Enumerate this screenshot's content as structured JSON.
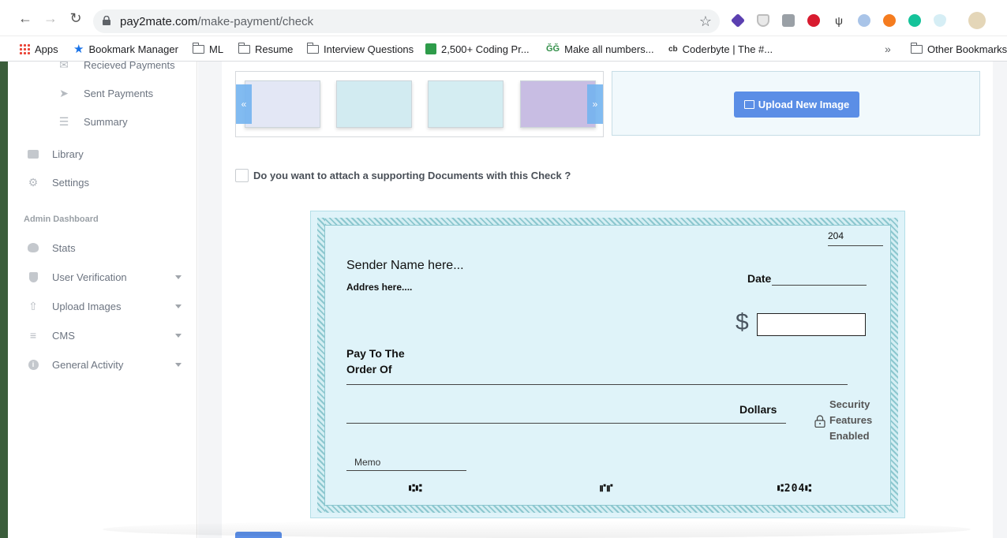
{
  "browser": {
    "url_host": "pay2mate.com",
    "url_path": "/make-payment/check"
  },
  "bookmarks": [
    {
      "label": "Apps",
      "icon": "apps-grid-icon"
    },
    {
      "label": "Bookmark Manager",
      "icon": "star-icon"
    },
    {
      "label": "ML",
      "icon": "folder-icon"
    },
    {
      "label": "Resume",
      "icon": "folder-icon"
    },
    {
      "label": "Interview Questions",
      "icon": "folder-icon"
    },
    {
      "label": "2,500+ Coding Pr...",
      "icon": "site-favicon"
    },
    {
      "label": "Make all numbers...",
      "icon": "gfg-favicon"
    },
    {
      "label": "Coderbyte | The #...",
      "icon": "coderbyte-favicon"
    }
  ],
  "bookmarks_more": "»",
  "other_bookmarks": "Other Bookmarks",
  "sidebar": {
    "sub_items": [
      {
        "label": "Recieved Payments",
        "icon": "envelope-open-icon"
      },
      {
        "label": "Sent Payments",
        "icon": "paper-plane-icon"
      },
      {
        "label": "Summary",
        "icon": "table-list-icon"
      }
    ],
    "items": [
      {
        "label": "Library",
        "icon": "briefcase-icon"
      },
      {
        "label": "Settings",
        "icon": "gear-icon"
      }
    ],
    "admin_heading": "Admin Dashboard",
    "admin_items": [
      {
        "label": "Stats",
        "icon": "palette-icon",
        "has_caret": false
      },
      {
        "label": "User Verification",
        "icon": "shield-icon",
        "has_caret": true
      },
      {
        "label": "Upload Images",
        "icon": "upload-icon",
        "has_caret": true
      },
      {
        "label": "CMS",
        "icon": "align-left-icon",
        "has_caret": true
      },
      {
        "label": "General Activity",
        "icon": "info-circle-icon",
        "has_caret": true
      }
    ]
  },
  "carousel": {
    "prev": "«",
    "next": "»",
    "thumbnail_colors": [
      "#e3e7f5",
      "#d2ebf1",
      "#d4edf2",
      "#c8bde3"
    ]
  },
  "upload": {
    "button_label": "Upload New Image"
  },
  "attach_documents_label": "Do you want to attach a supporting Documents with this Check ?",
  "check": {
    "number": "204",
    "sender_name": "Sender Name here...",
    "address": "Addres here....",
    "date_label": "Date",
    "currency_symbol": "$",
    "pay_to_line1": "Pay To The",
    "pay_to_line2": "Order Of",
    "dollars_label": "Dollars",
    "security_line1": "Security",
    "security_line2": "Features",
    "security_line3": "Enabled",
    "memo_label": "Memo",
    "micr_routing": "⑆⑆",
    "micr_account": "⑈⑈",
    "micr_check": "⑆204⑆"
  },
  "colors": {
    "accent": "#5b8ee6",
    "check_background": "#dff3f9",
    "border_pattern": "#8cc7cf"
  }
}
